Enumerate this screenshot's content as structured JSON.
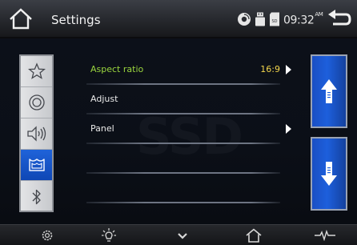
{
  "header": {
    "title": "Settings",
    "time": "09:32",
    "ampm": "AM",
    "status_icons": [
      "disc-icon",
      "usb-icon",
      "sd-card-icon"
    ]
  },
  "sidebar": {
    "items": [
      {
        "icon": "star-icon",
        "active": false
      },
      {
        "icon": "disc-icon",
        "active": false
      },
      {
        "icon": "speaker-icon",
        "active": false
      },
      {
        "icon": "screen-icon",
        "active": true
      },
      {
        "icon": "bluetooth-icon",
        "active": false
      }
    ]
  },
  "menu": {
    "items": [
      {
        "label": "Aspect ratio",
        "value": "16:9",
        "has_arrow": true,
        "selected": true
      },
      {
        "label": "Adjust",
        "value": "",
        "has_arrow": false,
        "selected": false
      },
      {
        "label": "Panel",
        "value": "",
        "has_arrow": true,
        "selected": false
      },
      {
        "label": "",
        "value": "",
        "has_arrow": false,
        "selected": false
      },
      {
        "label": "",
        "value": "",
        "has_arrow": false,
        "selected": false
      }
    ]
  },
  "scroll": {
    "up_icon": "arrow-up-icon",
    "down_icon": "arrow-down-icon"
  },
  "bottom_bar": {
    "icons": [
      "gear-icon",
      "brightness-icon",
      "chevron-down-icon",
      "home-icon",
      "equalizer-icon"
    ]
  },
  "watermark": "SSD",
  "colors": {
    "accent_blue": "#1d5fdc",
    "selected_label": "#9bd63e",
    "value_text": "#f3d64c"
  }
}
